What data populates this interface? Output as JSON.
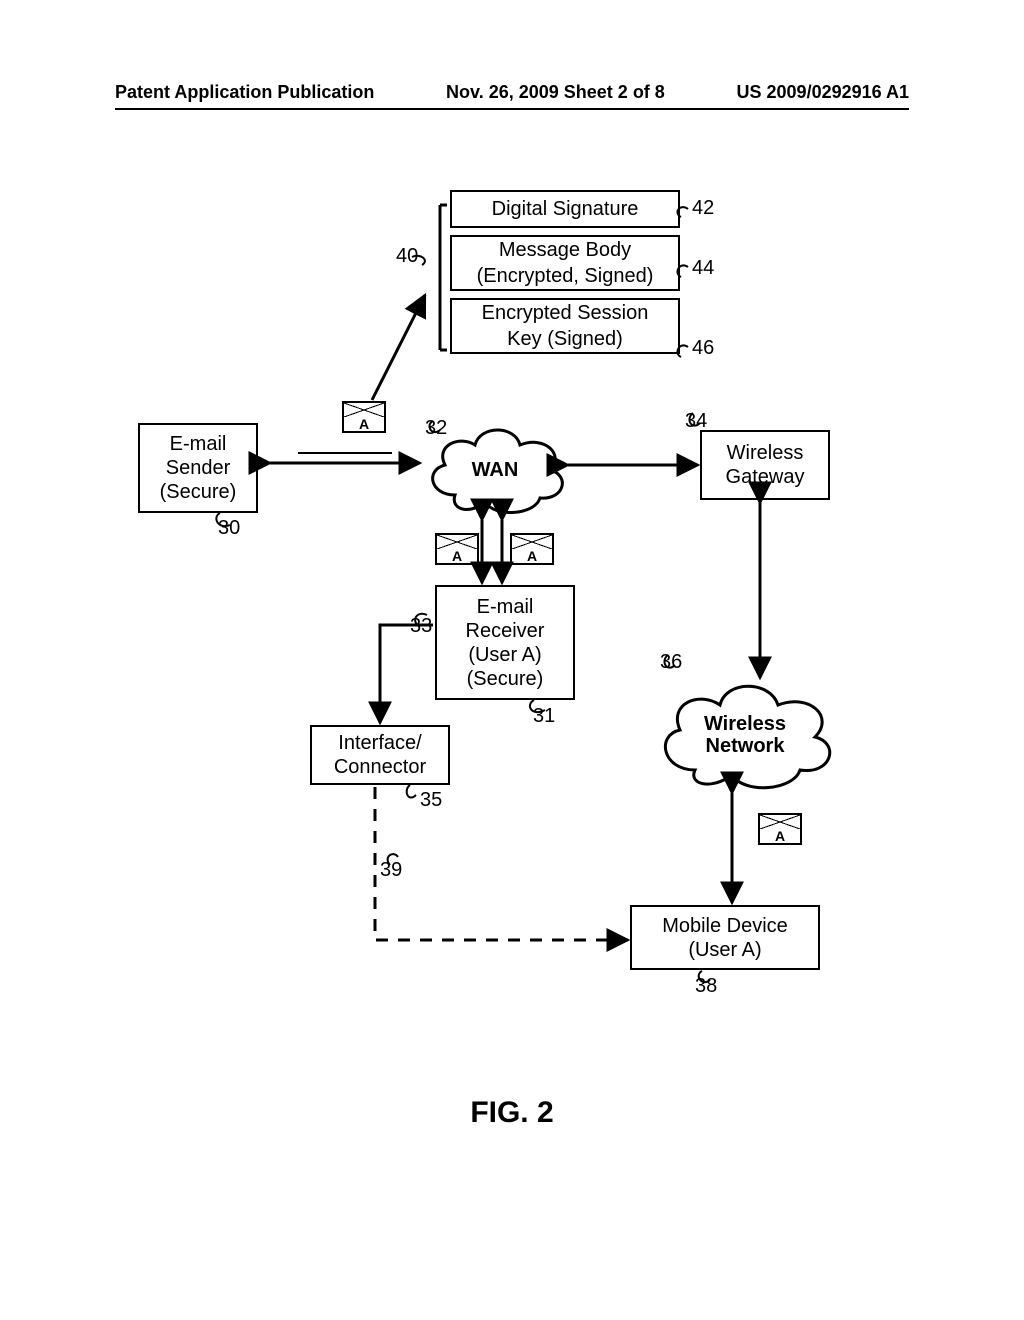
{
  "header": {
    "left": "Patent Application Publication",
    "center": "Nov. 26, 2009  Sheet 2 of 8",
    "right": "US 2009/0292916 A1"
  },
  "diagram": {
    "msg": {
      "sig": "Digital Signature",
      "body": "Message Body\n(Encrypted, Signed)",
      "key": "Encrypted Session\nKey  (Signed)"
    },
    "blocks": {
      "sender": "E-mail\nSender\n(Secure)",
      "wan": "WAN",
      "gateway": "Wireless\nGateway",
      "receiver": "E-mail\nReceiver\n(User A)\n(Secure)",
      "interface": "Interface/\nConnector",
      "wnet": "Wireless\nNetwork",
      "device": "Mobile Device\n(User A)"
    },
    "env_letter": "A",
    "refs": {
      "r30": "30",
      "r31": "31",
      "r32": "32",
      "r33": "33",
      "r34": "34",
      "r35": "35",
      "r36": "36",
      "r38": "38",
      "r39": "39",
      "r40": "40",
      "r42": "42",
      "r44": "44",
      "r46": "46"
    }
  },
  "caption": "FIG. 2"
}
